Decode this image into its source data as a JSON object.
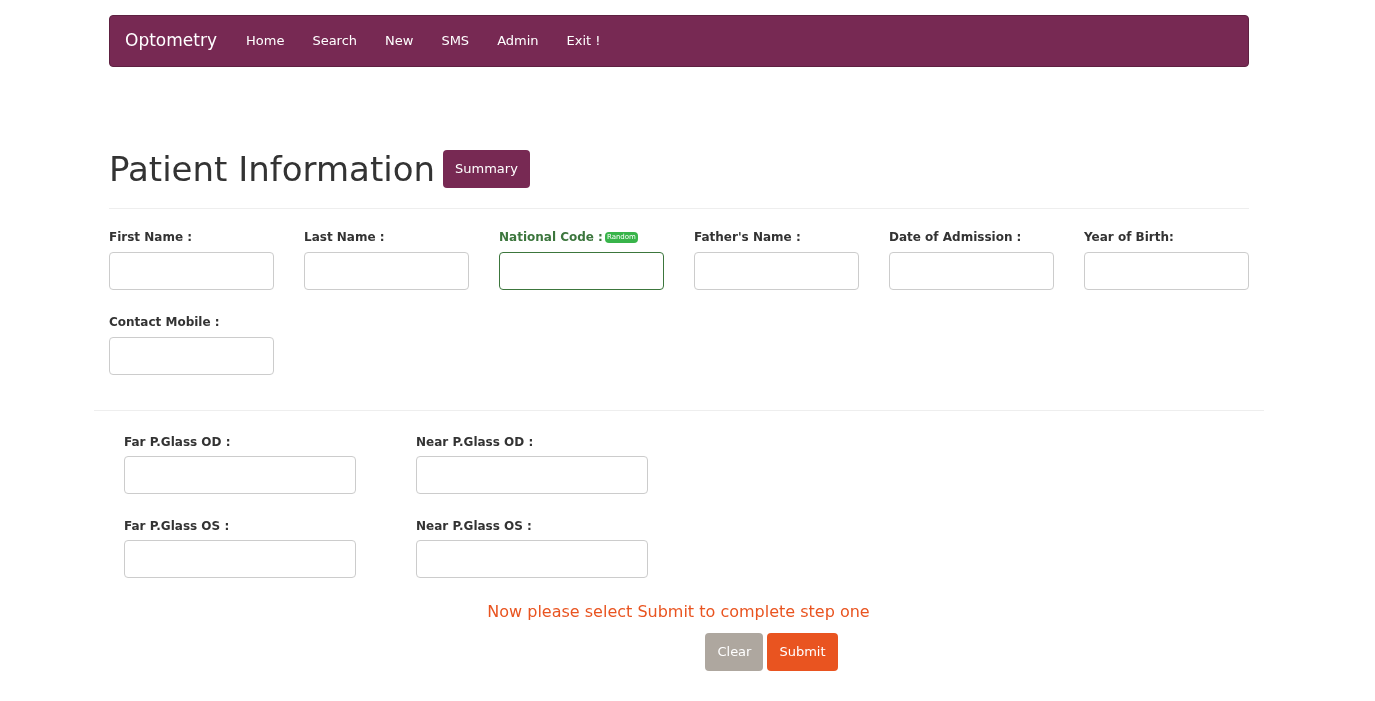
{
  "navbar": {
    "brand": "Optometry",
    "links": [
      "Home",
      "Search",
      "New",
      "SMS",
      "Admin",
      "Exit !"
    ]
  },
  "page": {
    "title": "Patient Information",
    "summary_button": "Summary"
  },
  "patient_fields": [
    {
      "label": "First Name :",
      "focused": false
    },
    {
      "label": "Last Name :",
      "focused": false
    },
    {
      "label": "National Code :",
      "focused": true,
      "badge": "Random"
    },
    {
      "label": "Father's Name :",
      "focused": false
    },
    {
      "label": "Date of Admission :",
      "focused": false
    },
    {
      "label": "Year of Birth:",
      "focused": false
    },
    {
      "label": "Contact Mobile :",
      "focused": false
    }
  ],
  "glass_fields": [
    {
      "label": "Far P.Glass OD :"
    },
    {
      "label": "Near P.Glass OD :"
    },
    {
      "label": "Far P.Glass OS :"
    },
    {
      "label": "Near P.Glass OS :"
    }
  ],
  "message": "Now please select Submit to complete step one",
  "buttons": [
    {
      "label": "Clear",
      "kind": "secondary"
    },
    {
      "label": "Submit",
      "kind": "primary"
    }
  ]
}
